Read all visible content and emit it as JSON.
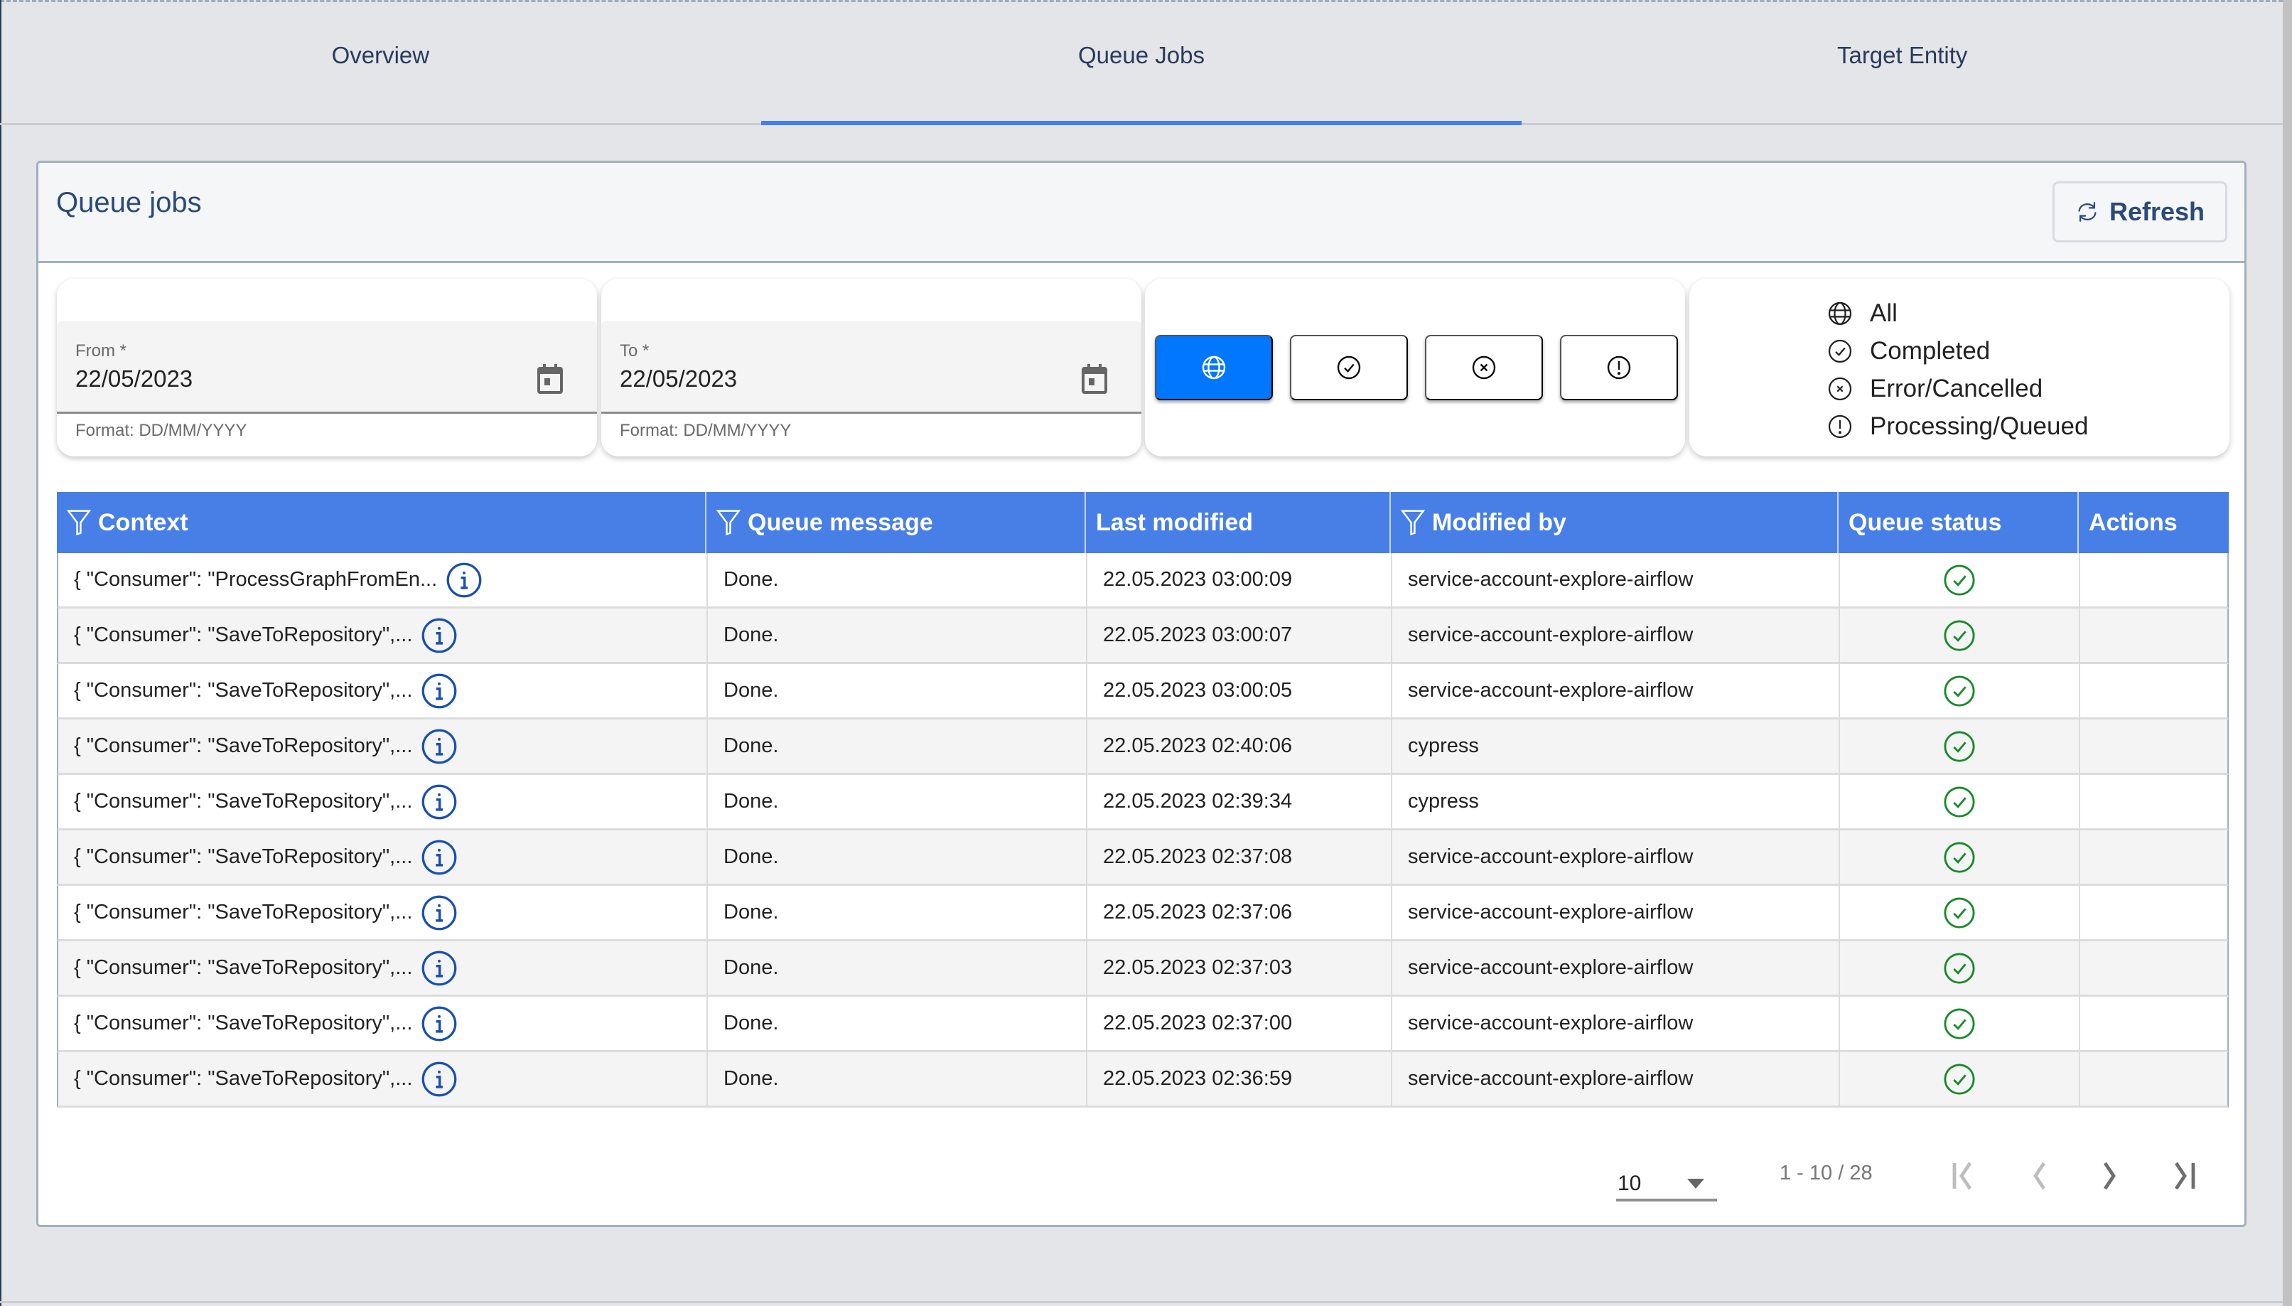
{
  "tabs": [
    {
      "label": "Overview",
      "active": false
    },
    {
      "label": "Queue Jobs",
      "active": true
    },
    {
      "label": "Target Entity",
      "active": false
    }
  ],
  "card": {
    "title": "Queue jobs",
    "refresh_label": "Refresh"
  },
  "filters": {
    "from": {
      "label": "From *",
      "value": "22/05/2023",
      "hint": "Format: DD/MM/YYYY"
    },
    "to": {
      "label": "To *",
      "value": "22/05/2023",
      "hint": "Format: DD/MM/YYYY"
    },
    "status_toggles": [
      {
        "icon": "globe-icon",
        "value": "All",
        "selected": true
      },
      {
        "icon": "check-circle-icon",
        "value": "Completed",
        "selected": false
      },
      {
        "icon": "x-circle-icon",
        "value": "Error/Cancelled",
        "selected": false
      },
      {
        "icon": "exclamation-circle-icon",
        "value": "Processing/Queued",
        "selected": false
      }
    ],
    "legend": [
      {
        "icon": "globe-icon",
        "label": "All"
      },
      {
        "icon": "check-circle-icon",
        "label": "Completed"
      },
      {
        "icon": "x-circle-icon",
        "label": "Error/Cancelled"
      },
      {
        "icon": "exclamation-circle-icon",
        "label": "Processing/Queued"
      }
    ]
  },
  "table": {
    "columns": [
      {
        "label": "Context",
        "filterable": true
      },
      {
        "label": "Queue message",
        "filterable": true
      },
      {
        "label": "Last modified",
        "filterable": false
      },
      {
        "label": "Modified by",
        "filterable": true
      },
      {
        "label": "Queue status",
        "filterable": false
      },
      {
        "label": "Actions",
        "filterable": false
      }
    ],
    "rows": [
      {
        "context": "{ \"Consumer\": \"ProcessGraphFromEn...",
        "message": "Done.",
        "modified": "22.05.2023 03:00:09",
        "by": "service-account-explore-airflow",
        "status": "completed"
      },
      {
        "context": "{ \"Consumer\": \"SaveToRepository\",...",
        "message": "Done.",
        "modified": "22.05.2023 03:00:07",
        "by": "service-account-explore-airflow",
        "status": "completed"
      },
      {
        "context": "{ \"Consumer\": \"SaveToRepository\",...",
        "message": "Done.",
        "modified": "22.05.2023 03:00:05",
        "by": "service-account-explore-airflow",
        "status": "completed"
      },
      {
        "context": "{ \"Consumer\": \"SaveToRepository\",...",
        "message": "Done.",
        "modified": "22.05.2023 02:40:06",
        "by": "cypress",
        "status": "completed"
      },
      {
        "context": "{ \"Consumer\": \"SaveToRepository\",...",
        "message": "Done.",
        "modified": "22.05.2023 02:39:34",
        "by": "cypress",
        "status": "completed"
      },
      {
        "context": "{ \"Consumer\": \"SaveToRepository\",...",
        "message": "Done.",
        "modified": "22.05.2023 02:37:08",
        "by": "service-account-explore-airflow",
        "status": "completed"
      },
      {
        "context": "{ \"Consumer\": \"SaveToRepository\",...",
        "message": "Done.",
        "modified": "22.05.2023 02:37:06",
        "by": "service-account-explore-airflow",
        "status": "completed"
      },
      {
        "context": "{ \"Consumer\": \"SaveToRepository\",...",
        "message": "Done.",
        "modified": "22.05.2023 02:37:03",
        "by": "service-account-explore-airflow",
        "status": "completed"
      },
      {
        "context": "{ \"Consumer\": \"SaveToRepository\",...",
        "message": "Done.",
        "modified": "22.05.2023 02:37:00",
        "by": "service-account-explore-airflow",
        "status": "completed"
      },
      {
        "context": "{ \"Consumer\": \"SaveToRepository\",...",
        "message": "Done.",
        "modified": "22.05.2023 02:36:59",
        "by": "service-account-explore-airflow",
        "status": "completed"
      }
    ]
  },
  "pagination": {
    "page_size": "10",
    "range": "1 - 10 / 28",
    "first_enabled": false,
    "prev_enabled": false,
    "next_enabled": true,
    "last_enabled": true
  },
  "colors": {
    "accent": "#477fe6",
    "toggle_selected": "#0077fe",
    "title": "#2b4a78",
    "status_completed": "#1a8a2a",
    "info_icon": "#1a4fb0"
  }
}
